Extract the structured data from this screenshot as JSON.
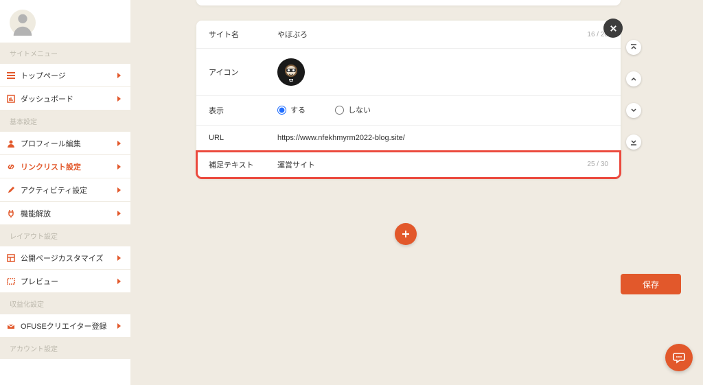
{
  "sidebar": {
    "section_site_menu": "サイトメニュー",
    "items_site": [
      {
        "id": "top",
        "label": "トップページ",
        "icon": "hamburger-icon"
      },
      {
        "id": "dashboard",
        "label": "ダッシュボード",
        "icon": "chart-icon"
      }
    ],
    "section_basic": "基本設定",
    "items_basic": [
      {
        "id": "profile",
        "label": "プロフィール編集",
        "icon": "person-icon"
      },
      {
        "id": "linklist",
        "label": "リンクリスト設定",
        "icon": "link-icon",
        "active": true
      },
      {
        "id": "activity",
        "label": "アクティビティ設定",
        "icon": "pen-icon"
      },
      {
        "id": "unlock",
        "label": "機能解放",
        "icon": "plug-icon"
      }
    ],
    "section_layout": "レイアウト設定",
    "items_layout": [
      {
        "id": "customize",
        "label": "公開ページカスタマイズ",
        "icon": "layout-icon"
      },
      {
        "id": "preview",
        "label": "プレビュー",
        "icon": "window-icon"
      }
    ],
    "section_monetize": "収益化設定",
    "items_monetize": [
      {
        "id": "ofuse",
        "label": "OFUSEクリエイター登録",
        "icon": "ofuse-icon"
      }
    ],
    "section_account": "アカウント設定"
  },
  "form": {
    "site_name": {
      "label": "サイト名",
      "value": "やぼぶろ",
      "count": "16 / 20"
    },
    "icon": {
      "label": "アイコン"
    },
    "display": {
      "label": "表示",
      "opt_on": "する",
      "opt_off": "しない",
      "value": "on"
    },
    "url": {
      "label": "URL",
      "value": "https://www.nfekhmyrm2022-blog.site/"
    },
    "extra": {
      "label": "補足テキスト",
      "value": "運営サイト",
      "count": "25 / 30"
    }
  },
  "buttons": {
    "save": "保存"
  },
  "colors": {
    "accent": "#e2582b",
    "highlight": "#eb4a3e"
  }
}
